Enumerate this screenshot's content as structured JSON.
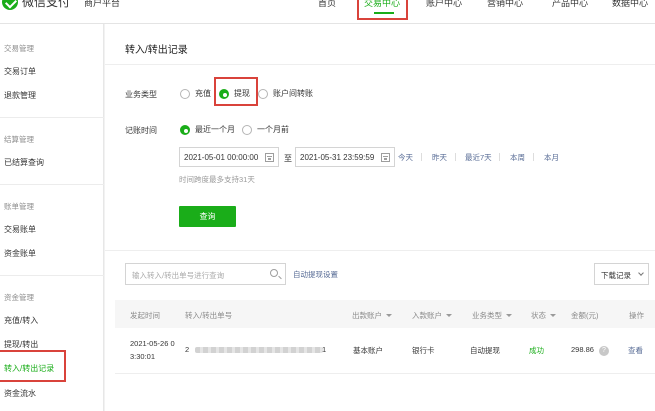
{
  "header": {
    "logo_text": "微信支付",
    "platform": "商户平台",
    "nav": [
      "首页",
      "交易中心",
      "账户中心",
      "营销中心",
      "产品中心",
      "数据中心"
    ],
    "active_nav": "交易中心"
  },
  "sidebar": {
    "groups": [
      {
        "title": "交易管理",
        "items": [
          "交易订单",
          "退款管理"
        ]
      },
      {
        "title": "结算管理",
        "items": [
          "已结算查询"
        ]
      },
      {
        "title": "账单管理",
        "items": [
          "交易账单",
          "资金账单"
        ]
      },
      {
        "title": "资金管理",
        "items": [
          "充值/转入",
          "提现/转出",
          "转入/转出记录",
          "资金流水"
        ]
      }
    ],
    "active_item": "转入/转出记录"
  },
  "main": {
    "title": "转入/转出记录",
    "business_type": {
      "label": "业务类型",
      "options": [
        "充值",
        "提现",
        "账户间转账"
      ],
      "selected": "提现"
    },
    "record_time": {
      "label": "记账时间",
      "options": [
        "最近一个月",
        "一个月前"
      ],
      "selected": "最近一个月"
    },
    "date_range": {
      "start": "2021-05-01 00:00:00",
      "separator": "至",
      "end": "2021-05-31 23:59:59",
      "quick": [
        "今天",
        "昨天",
        "最近7天",
        "本周",
        "本月"
      ],
      "hint": "时间跨度最多支持31天"
    },
    "query_button": "查询",
    "search": {
      "placeholder": "输入转入/转出单号进行查询",
      "auto_link": "自动提现设置",
      "download": "下载记录"
    },
    "table": {
      "columns": [
        "发起时间",
        "转入/转出单号",
        "出款账户",
        "入款账户",
        "业务类型",
        "状态",
        "金额(元)",
        "操作"
      ],
      "rows": [
        {
          "time_line1": "2021-05-26 0",
          "time_line2": "3:30:01",
          "order_prefix": "2",
          "order_suffix": "1",
          "from_account": "基本账户",
          "to_account": "银行卡",
          "business": "自动提现",
          "status": "成功",
          "amount": "298.86",
          "action": "查看"
        }
      ]
    }
  },
  "colors": {
    "accent": "#1aad19",
    "link": "#576b95",
    "highlight_box": "#d9433b"
  }
}
